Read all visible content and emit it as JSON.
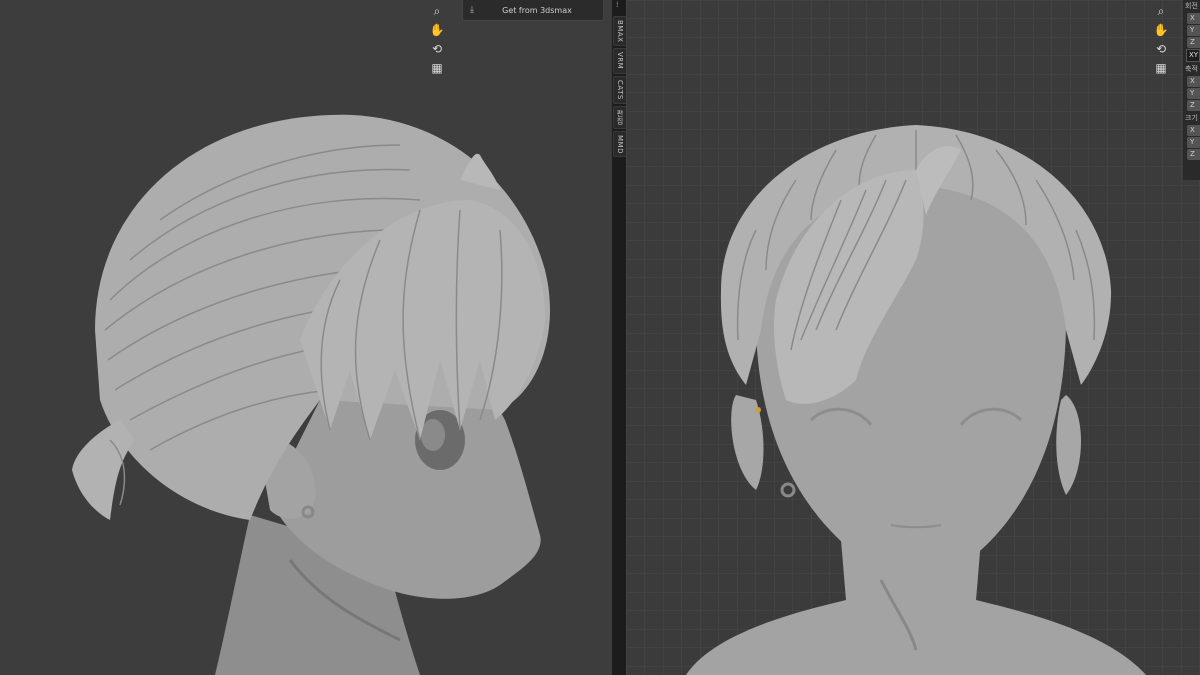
{
  "left_viewport": {
    "nav_icons": [
      "zoom-icon",
      "pan-hand-icon",
      "orbit-icon",
      "grid-icon"
    ],
    "get_button_label": "Get from 3dsmax"
  },
  "sidebar_tabs": [
    "BMAX",
    "VRM",
    "CATS",
    "편집",
    "MMD"
  ],
  "right_viewport": {
    "nav_icons": [
      "zoom-icon",
      "pan-hand-icon",
      "orbit-icon",
      "grid-icon"
    ]
  },
  "properties_panel": {
    "rotation_label": "회전",
    "rotation_fields": [
      "X",
      "Y",
      "Z"
    ],
    "rotation_mode": "XY",
    "axis_label": "축적",
    "axis_fields": [
      "X",
      "Y",
      "Z"
    ],
    "size_label": "크기",
    "size_fields": [
      "X",
      "Y",
      "Z"
    ]
  }
}
